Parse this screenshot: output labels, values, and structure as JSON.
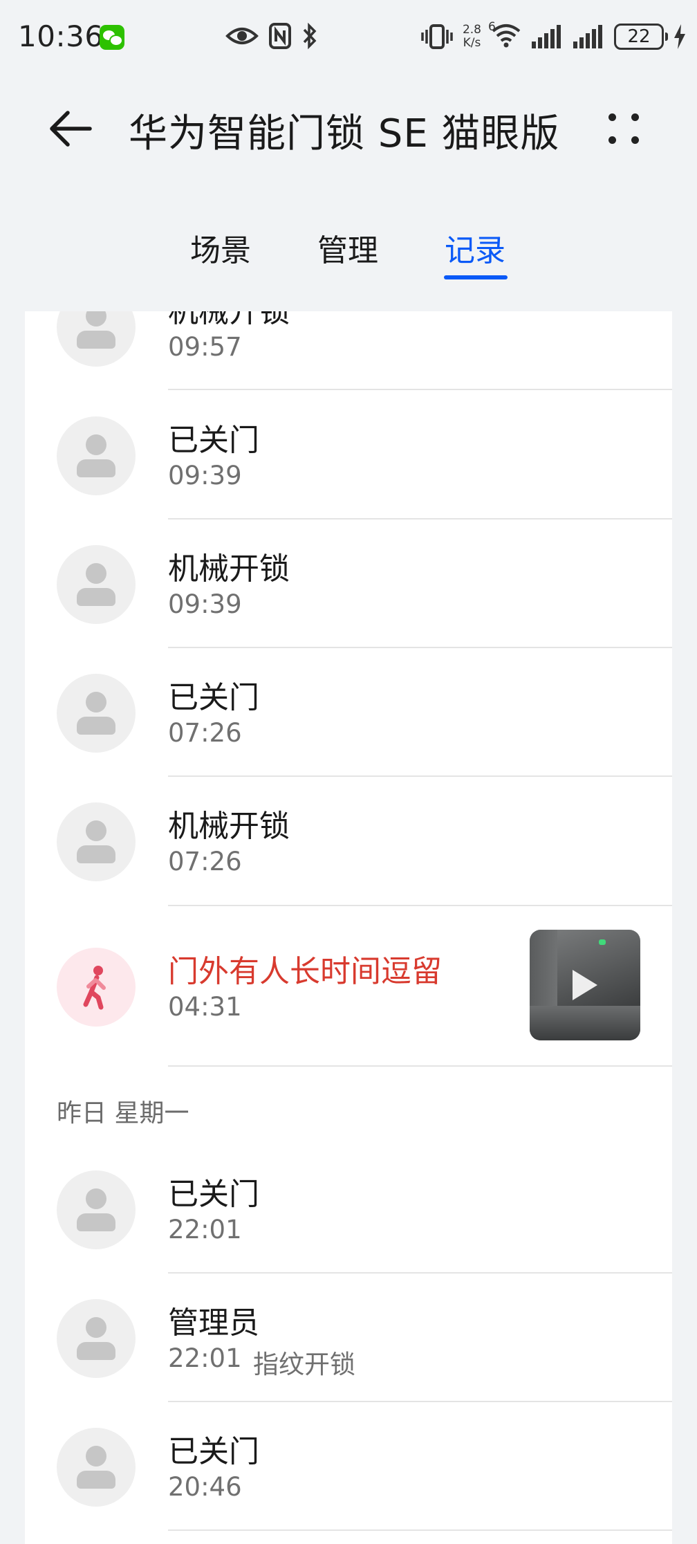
{
  "status_bar": {
    "time": "10:36",
    "net_speed_value": "2.8",
    "net_speed_unit": "K/s",
    "wifi_badge": "6",
    "battery": "22",
    "icons": [
      "wechat-icon",
      "eye-icon",
      "nfc-icon",
      "bluetooth-icon",
      "vibrate-icon",
      "wifi-icon",
      "signal-icon",
      "signal-icon",
      "battery-icon",
      "charging-icon"
    ]
  },
  "header": {
    "title": "华为智能门锁 SE 猫眼版"
  },
  "tabs": [
    {
      "label": "场景"
    },
    {
      "label": "管理"
    },
    {
      "label": "记录"
    }
  ],
  "active_tab": "记录",
  "records": [
    {
      "title": "机械开锁",
      "time": "09:57"
    },
    {
      "title": "已关门",
      "time": "09:39"
    },
    {
      "title": "机械开锁",
      "time": "09:39"
    },
    {
      "title": "已关门",
      "time": "07:26"
    },
    {
      "title": "机械开锁",
      "time": "07:26"
    },
    {
      "title": "门外有人长时间逗留",
      "time": "04:31",
      "alert": true,
      "icon": "walking-person-icon",
      "thumbnail_icon": "play-icon"
    }
  ],
  "section_yesterday": {
    "label": "昨日 星期一",
    "records": [
      {
        "title": "已关门",
        "time": "22:01"
      },
      {
        "title": "管理员",
        "time": "22:01",
        "detail": "指纹开锁"
      },
      {
        "title": "已关门",
        "time": "20:46"
      }
    ]
  },
  "colors": {
    "accent": "#0a59f7",
    "alert": "#d83a2e",
    "background": "#f1f3f5",
    "card": "#ffffff"
  }
}
